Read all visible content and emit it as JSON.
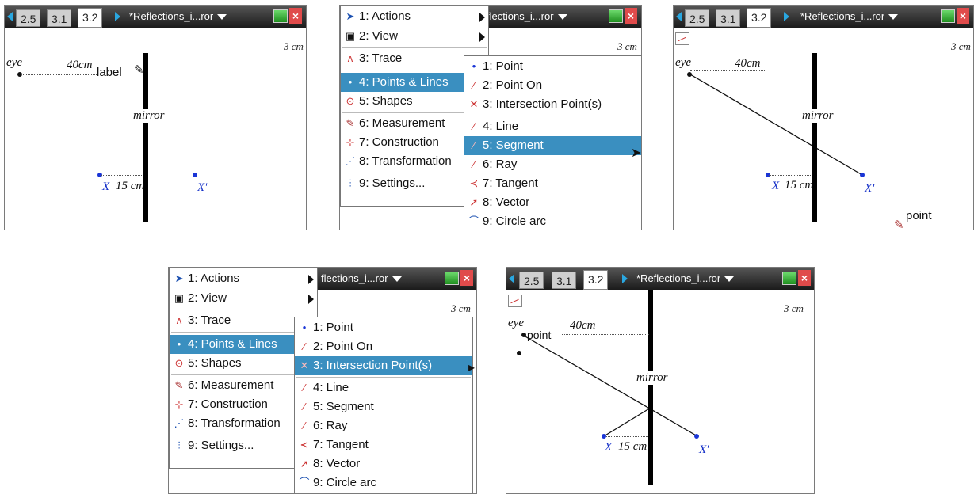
{
  "tabs": [
    "2.5",
    "3.1",
    "3.2"
  ],
  "active_tab": "3.2",
  "doc_title": "*Reflections_i...ror",
  "doc_title_short": "flections_i...ror",
  "scale": "3 cm",
  "labels": {
    "eye": "eye",
    "dist_40": "40cm",
    "dist_15": "15 cm",
    "x": "X",
    "x_prime": "X'",
    "mirror": "mirror",
    "label_tool": "label",
    "point_tool": "point"
  },
  "main_menu": [
    {
      "num": "1: Actions",
      "icon": "arrow-cursor-icon"
    },
    {
      "num": "2: View",
      "icon": "view-icon"
    },
    {
      "num": "3: Trace",
      "icon": "trace-icon"
    },
    {
      "num": "4: Points & Lines",
      "icon": "points-lines-icon"
    },
    {
      "num": "5: Shapes",
      "icon": "shapes-icon"
    },
    {
      "num": "6: Measurement",
      "icon": "measurement-icon"
    },
    {
      "num": "7: Construction",
      "icon": "construction-icon"
    },
    {
      "num": "8: Transformation",
      "icon": "transformation-icon"
    },
    {
      "num": "9: Settings...",
      "icon": "settings-icon"
    }
  ],
  "sub_menu": [
    {
      "num": "1: Point",
      "icon": "point-icon"
    },
    {
      "num": "2: Point On",
      "icon": "point-on-icon"
    },
    {
      "num": "3: Intersection Point(s)",
      "icon": "intersection-icon"
    },
    {
      "num": "4: Line",
      "icon": "line-icon"
    },
    {
      "num": "5: Segment",
      "icon": "segment-icon"
    },
    {
      "num": "6: Ray",
      "icon": "ray-icon"
    },
    {
      "num": "7: Tangent",
      "icon": "tangent-icon"
    },
    {
      "num": "8: Vector",
      "icon": "vector-icon"
    },
    {
      "num": "9: Circle arc",
      "icon": "circle-arc-icon"
    }
  ],
  "colors": {
    "highlight": "#3a8fc0",
    "tab_arrow": "#2aa7e0",
    "point_blue": "#1a35d6"
  }
}
